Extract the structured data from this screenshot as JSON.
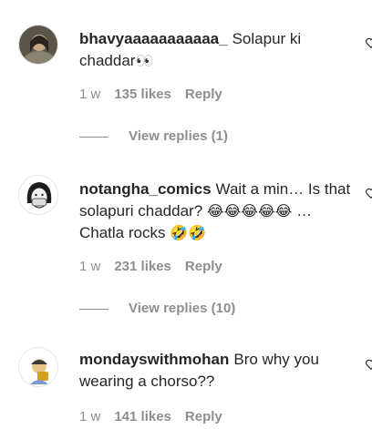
{
  "comments": [
    {
      "username": "bhavyaaaaaaaaaaa_",
      "text_before": "Solapur ki chaddar",
      "emoji_suffix": "👀",
      "time": "1 w",
      "likes": "135 likes",
      "reply": "Reply",
      "view_replies": "View replies (1)"
    },
    {
      "username": "notangha_comics",
      "text_before": "Wait a min… Is that solapuri chaddar? ",
      "emoji_a": "😂😂😂😂😂",
      "text_mid": " … Chatla rocks ",
      "emoji_b": "🤣🤣",
      "time": "1 w",
      "likes": "231 likes",
      "reply": "Reply",
      "view_replies": "View replies (10)"
    },
    {
      "username": "mondayswithmohan",
      "text_before": "Bro why you wearing a chorso??",
      "time": "1 w",
      "likes": "141 likes",
      "reply": "Reply"
    }
  ]
}
